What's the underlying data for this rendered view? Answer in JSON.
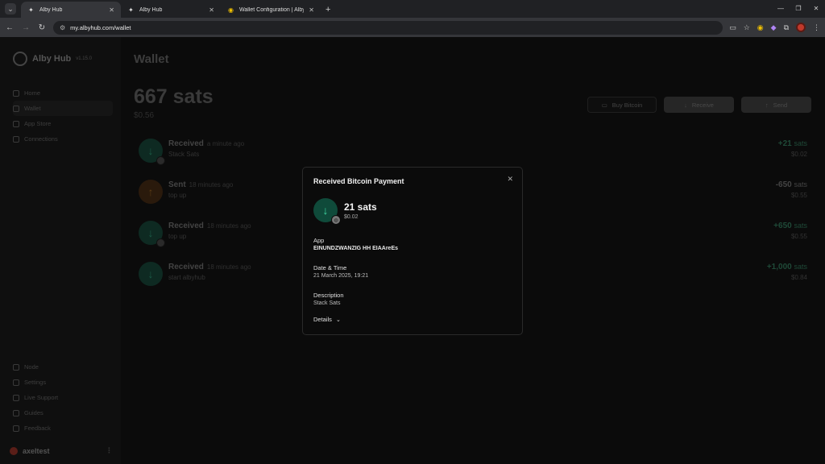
{
  "browser": {
    "tabs": [
      {
        "title": "Alby Hub",
        "active": true
      },
      {
        "title": "Alby Hub",
        "active": false
      },
      {
        "title": "Wallet Configuration | Alby: Yo",
        "active": false
      }
    ],
    "url": "my.albyhub.com/wallet"
  },
  "sidebar": {
    "brand": "Alby Hub",
    "version": "v1.15.0",
    "nav": [
      {
        "label": "Home",
        "icon": "home-icon"
      },
      {
        "label": "Wallet",
        "icon": "wallet-icon",
        "active": true
      },
      {
        "label": "App Store",
        "icon": "apps-icon"
      },
      {
        "label": "Connections",
        "icon": "connections-icon"
      }
    ],
    "bottom": [
      {
        "label": "Node",
        "icon": "node-icon"
      },
      {
        "label": "Settings",
        "icon": "gear-icon"
      },
      {
        "label": "Live Support",
        "icon": "support-icon"
      },
      {
        "label": "Guides",
        "icon": "guides-icon"
      },
      {
        "label": "Feedback",
        "icon": "feedback-icon"
      }
    ],
    "user": "axeltest"
  },
  "wallet": {
    "title": "Wallet",
    "balance": "667 sats",
    "fiat": "$0.56",
    "buttons": {
      "buy": "Buy Bitcoin",
      "receive": "Receive",
      "send": "Send"
    },
    "transactions": [
      {
        "type": "received",
        "title": "Received",
        "time": "a minute ago",
        "desc": "Stack Sats",
        "amount": "+21",
        "unit": "sats",
        "fiat": "$0.02"
      },
      {
        "type": "sent",
        "title": "Sent",
        "time": "18 minutes ago",
        "desc": "top up",
        "amount": "-650",
        "unit": "sats",
        "fiat": "$0.55"
      },
      {
        "type": "received",
        "title": "Received",
        "time": "18 minutes ago",
        "desc": "top up",
        "amount": "+650",
        "unit": "sats",
        "fiat": "$0.55"
      },
      {
        "type": "received",
        "title": "Received",
        "time": "18 minutes ago",
        "desc": "start albyhub",
        "amount": "+1,000",
        "unit": "sats",
        "fiat": "$0.84"
      }
    ]
  },
  "modal": {
    "title": "Received Bitcoin Payment",
    "amount": "21 sats",
    "fiat": "$0.02",
    "app_label": "App",
    "app_value": "EINUNDZWANZIG HH EIAAreEs",
    "date_label": "Date & Time",
    "date_value": "21 March 2025, 19:21",
    "desc_label": "Description",
    "desc_value": "Stack Sats",
    "details": "Details"
  }
}
